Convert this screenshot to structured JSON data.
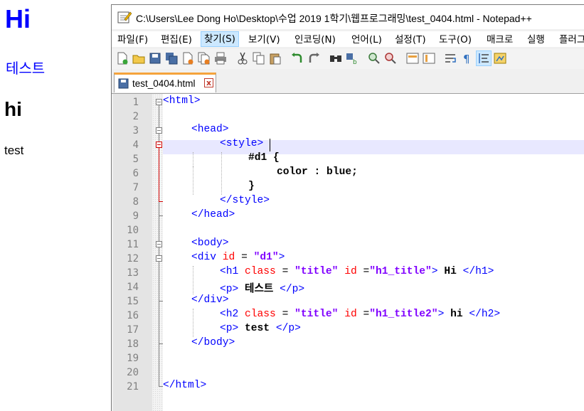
{
  "browser_page": {
    "h1": "Hi",
    "p1": "테스트",
    "h2": "hi",
    "p2": "test"
  },
  "window": {
    "title": "C:\\Users\\Lee Dong Ho\\Desktop\\수업 2019 1학기\\웹프로그래밍\\test_0404.html - Notepad++"
  },
  "menu": [
    "파일(F)",
    "편집(E)",
    "찾기(S)",
    "보기(V)",
    "인코딩(N)",
    "언어(L)",
    "설정(T)",
    "도구(O)",
    "매크로",
    "실행",
    "플러그인"
  ],
  "active_menu_index": 2,
  "tab": {
    "label": "test_0404.html",
    "close": "x"
  },
  "line_numbers": [
    "1",
    "2",
    "3",
    "4",
    "5",
    "6",
    "7",
    "8",
    "9",
    "10",
    "11",
    "12",
    "13",
    "14",
    "15",
    "16",
    "17",
    "18",
    "19",
    "20",
    "21"
  ],
  "current_line": 4,
  "code": {
    "l1": "<html>",
    "l3": "<head>",
    "l4": "<style>",
    "l5": "#d1 {",
    "l6": "color : blue;",
    "l7": "}",
    "l8": "</style>",
    "l9": "</head>",
    "l11": "<body>",
    "l12": {
      "open": "<div ",
      "attr": "id",
      "eq": " = ",
      "val": "\"d1\"",
      "close": ">"
    },
    "l13": {
      "open": "<h1 ",
      "attr1": "class",
      "eq1": " = ",
      "val1": "\"title\"",
      "sp": " ",
      "attr2": "id",
      "eq2": " =",
      "val2": "\"h1_title\"",
      "close": ">",
      "text": " Hi ",
      "end": "</h1>"
    },
    "l14": {
      "open": "<p>",
      "text": " 테스트 ",
      "end": "</p>"
    },
    "l15": "</div>",
    "l16": {
      "open": "<h2 ",
      "attr1": "class",
      "eq1": " = ",
      "val1": "\"title\"",
      "sp": " ",
      "attr2": "id",
      "eq2": " =",
      "val2": "\"h1_title2\"",
      "close": ">",
      "text": " hi ",
      "end": "</h2>"
    },
    "l17": {
      "open": "<p>",
      "text": " test ",
      "end": "</p>"
    },
    "l18": "</body>",
    "l21": "</html>"
  },
  "colors": {
    "tag": "#0000ff",
    "attribute": "#ff0000",
    "value": "#8000ff",
    "current_line_bg": "#e8e8ff",
    "tab_accent": "#f5a33c"
  },
  "toolbar_icons": [
    "new-file-icon",
    "open-file-icon",
    "save-icon",
    "save-all-icon",
    "close-icon",
    "close-all-icon",
    "print-icon",
    "cut-icon",
    "copy-icon",
    "paste-icon",
    "undo-icon",
    "redo-icon",
    "find-icon",
    "replace-icon",
    "zoom-in-icon",
    "zoom-out-icon",
    "sync-vertical-icon",
    "sync-horizontal-icon",
    "word-wrap-icon",
    "show-all-chars-icon",
    "indent-guide-icon",
    "doc-map-icon"
  ]
}
